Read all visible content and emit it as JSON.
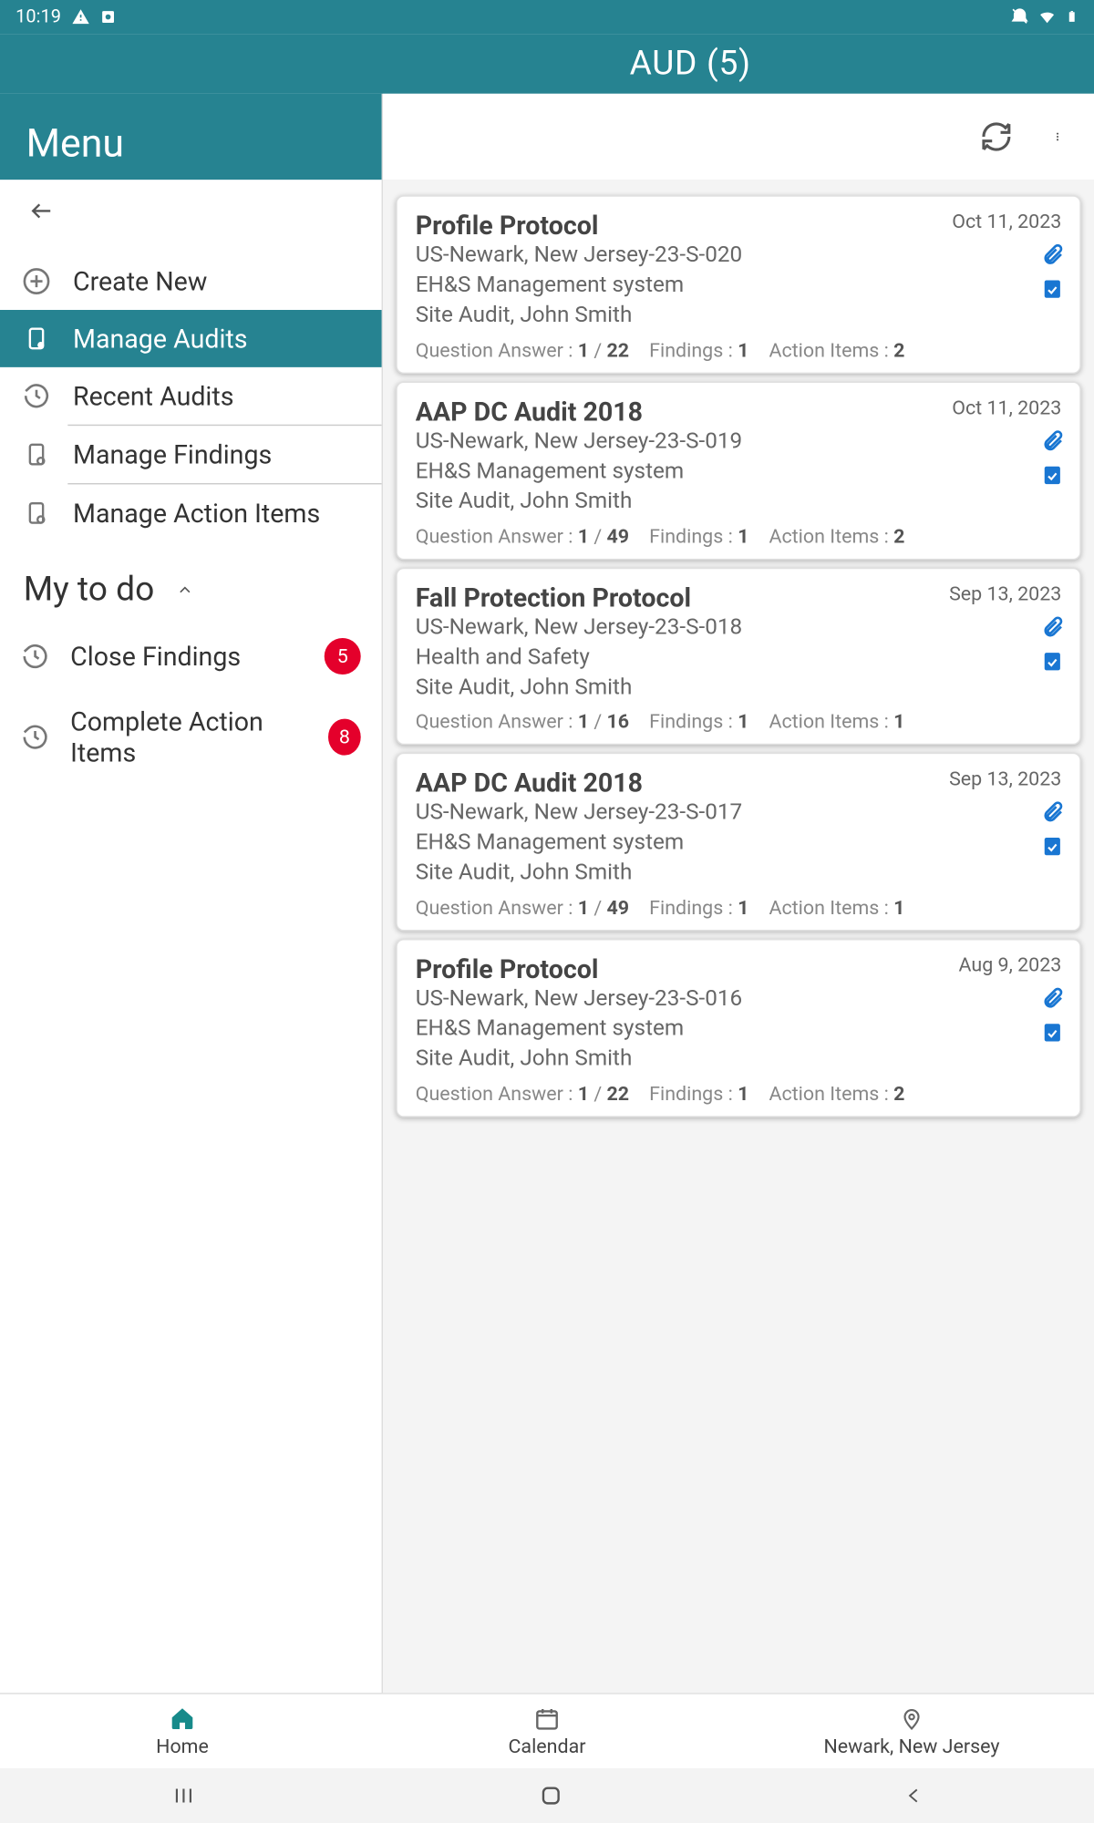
{
  "statusbar": {
    "time": "10:19"
  },
  "header": {
    "title": "AUD (5)"
  },
  "sidebar": {
    "menu_label": "Menu",
    "items": [
      {
        "label": "Create New"
      },
      {
        "label": "Manage Audits"
      },
      {
        "label": "Recent Audits"
      },
      {
        "label": "Manage Findings"
      },
      {
        "label": "Manage Action Items"
      }
    ],
    "todo_header": "My to do",
    "todo_items": [
      {
        "label": "Close Findings",
        "badge": "5"
      },
      {
        "label": "Complete Action Items",
        "badge": "8"
      }
    ]
  },
  "audits": [
    {
      "title": "Profile Protocol",
      "date": "Oct 11, 2023",
      "loc": "US-Newark, New Jersey-23-S-020",
      "system": "EH&S Management system",
      "type_auditor": "Site Audit, John Smith",
      "qa_label": "Question Answer : ",
      "qa_done": "1",
      "qa_sep": " / ",
      "qa_total": "22",
      "find_label": "Findings : ",
      "find_val": "1",
      "ai_label": "Action Items : ",
      "ai_val": "2"
    },
    {
      "title": "AAP DC Audit 2018",
      "date": "Oct 11, 2023",
      "loc": "US-Newark, New Jersey-23-S-019",
      "system": "EH&S Management system",
      "type_auditor": "Site Audit, John Smith",
      "qa_label": "Question Answer : ",
      "qa_done": "1",
      "qa_sep": " / ",
      "qa_total": "49",
      "find_label": "Findings : ",
      "find_val": "1",
      "ai_label": "Action Items : ",
      "ai_val": "2"
    },
    {
      "title": "Fall Protection Protocol",
      "date": "Sep 13, 2023",
      "loc": "US-Newark, New Jersey-23-S-018",
      "system": "Health and Safety",
      "type_auditor": "Site Audit, John Smith",
      "qa_label": "Question Answer : ",
      "qa_done": "1",
      "qa_sep": " / ",
      "qa_total": "16",
      "find_label": "Findings : ",
      "find_val": "1",
      "ai_label": "Action Items : ",
      "ai_val": "1"
    },
    {
      "title": "AAP DC Audit 2018",
      "date": "Sep 13, 2023",
      "loc": "US-Newark, New Jersey-23-S-017",
      "system": "EH&S Management system",
      "type_auditor": "Site Audit, John Smith",
      "qa_label": "Question Answer : ",
      "qa_done": "1",
      "qa_sep": " / ",
      "qa_total": "49",
      "find_label": "Findings : ",
      "find_val": "1",
      "ai_label": "Action Items : ",
      "ai_val": "1"
    },
    {
      "title": "Profile Protocol",
      "date": "Aug 9, 2023",
      "loc": "US-Newark, New Jersey-23-S-016",
      "system": "EH&S Management system",
      "type_auditor": "Site Audit, John Smith",
      "qa_label": "Question Answer : ",
      "qa_done": "1",
      "qa_sep": " / ",
      "qa_total": "22",
      "find_label": "Findings : ",
      "find_val": "1",
      "ai_label": "Action Items : ",
      "ai_val": "2"
    }
  ],
  "footer": {
    "home": "Home",
    "calendar": "Calendar",
    "location": "Newark, New Jersey"
  }
}
